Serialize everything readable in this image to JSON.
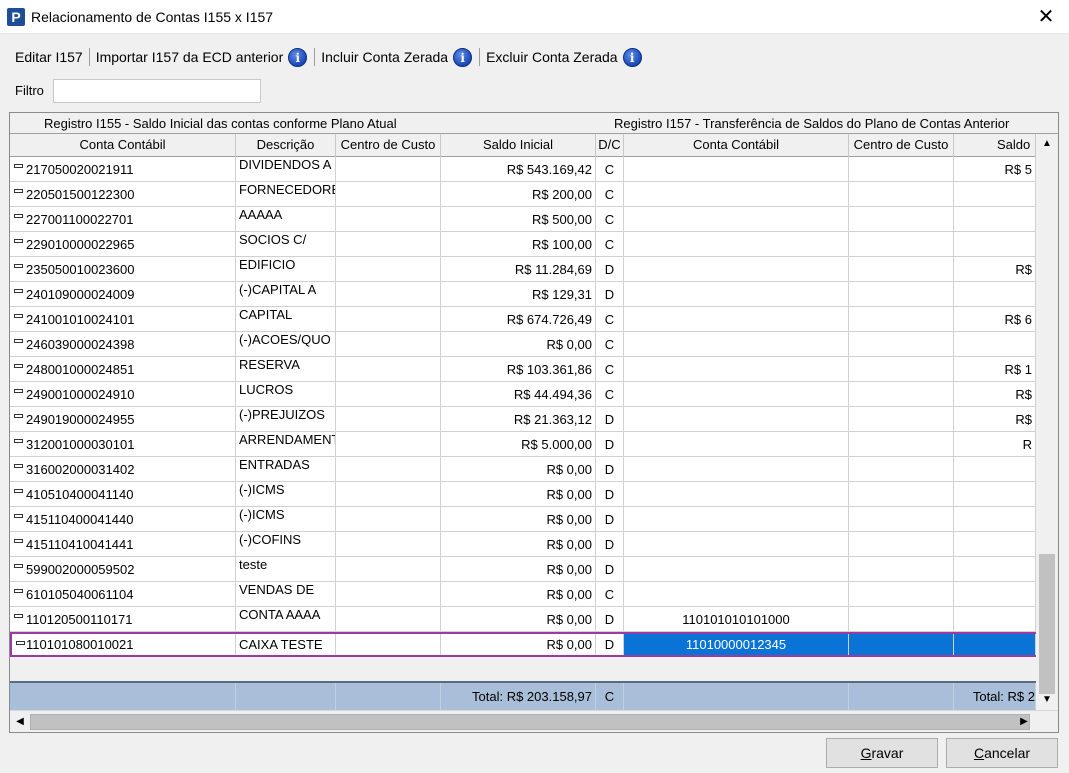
{
  "window": {
    "title": "Relacionamento de Contas I155 x I157",
    "close_glyph": "✕"
  },
  "toolbar": {
    "edit_label": "Editar I157",
    "import_label": "Importar I157 da ECD anterior",
    "include_label": "Incluir Conta Zerada",
    "exclude_label": "Excluir Conta Zerada",
    "info_glyph": "i"
  },
  "filter": {
    "label": "Filtro",
    "value": ""
  },
  "grid": {
    "group_left": "Registro I155 - Saldo Inicial das contas conforme Plano Atual",
    "group_right": "Registro I157 - Transferência de Saldos do Plano de Contas Anterior",
    "columns": [
      "Conta Contábil",
      "Descrição",
      "Centro de Custo",
      "Saldo Inicial",
      "D/C",
      "Conta Contábil",
      "Centro de Custo",
      "Saldo Ini"
    ],
    "rows": [
      {
        "conta": "217050020021911",
        "desc": "DIVIDENDOS A",
        "cc": "",
        "saldo": "R$ 543.169,42",
        "dc": "C",
        "conta2": "",
        "cc2": "",
        "saldo2": "R$ 5"
      },
      {
        "conta": "220501500122300",
        "desc": "FORNECEDORE",
        "cc": "",
        "saldo": "R$ 200,00",
        "dc": "C",
        "conta2": "",
        "cc2": "",
        "saldo2": ""
      },
      {
        "conta": "227001100022701",
        "desc": "AAAAA",
        "cc": "",
        "saldo": "R$ 500,00",
        "dc": "C",
        "conta2": "",
        "cc2": "",
        "saldo2": ""
      },
      {
        "conta": "229010000022965",
        "desc": "SOCIOS C/",
        "cc": "",
        "saldo": "R$ 100,00",
        "dc": "C",
        "conta2": "",
        "cc2": "",
        "saldo2": ""
      },
      {
        "conta": "235050010023600",
        "desc": "EDIFICIO",
        "cc": "",
        "saldo": "R$ 11.284,69",
        "dc": "D",
        "conta2": "",
        "cc2": "",
        "saldo2": "R$"
      },
      {
        "conta": "240109000024009",
        "desc": "(-)CAPITAL A",
        "cc": "",
        "saldo": "R$ 129,31",
        "dc": "D",
        "conta2": "",
        "cc2": "",
        "saldo2": ""
      },
      {
        "conta": "241001010024101",
        "desc": "CAPITAL",
        "cc": "",
        "saldo": "R$ 674.726,49",
        "dc": "C",
        "conta2": "",
        "cc2": "",
        "saldo2": "R$ 6"
      },
      {
        "conta": "246039000024398",
        "desc": "(-)ACOES/QUO",
        "cc": "",
        "saldo": "R$ 0,00",
        "dc": "C",
        "conta2": "",
        "cc2": "",
        "saldo2": ""
      },
      {
        "conta": "248001000024851",
        "desc": "RESERVA",
        "cc": "",
        "saldo": "R$ 103.361,86",
        "dc": "C",
        "conta2": "",
        "cc2": "",
        "saldo2": "R$ 1"
      },
      {
        "conta": "249001000024910",
        "desc": "LUCROS",
        "cc": "",
        "saldo": "R$ 44.494,36",
        "dc": "C",
        "conta2": "",
        "cc2": "",
        "saldo2": "R$"
      },
      {
        "conta": "249019000024955",
        "desc": "(-)PREJUIZOS",
        "cc": "",
        "saldo": "R$ 21.363,12",
        "dc": "D",
        "conta2": "",
        "cc2": "",
        "saldo2": "R$"
      },
      {
        "conta": "312001000030101",
        "desc": "ARRENDAMENT",
        "cc": "",
        "saldo": "R$ 5.000,00",
        "dc": "D",
        "conta2": "",
        "cc2": "",
        "saldo2": "R"
      },
      {
        "conta": "316002000031402",
        "desc": "ENTRADAS",
        "cc": "",
        "saldo": "R$ 0,00",
        "dc": "D",
        "conta2": "",
        "cc2": "",
        "saldo2": ""
      },
      {
        "conta": "410510400041140",
        "desc": "(-)ICMS",
        "cc": "",
        "saldo": "R$ 0,00",
        "dc": "D",
        "conta2": "",
        "cc2": "",
        "saldo2": ""
      },
      {
        "conta": "415110400041440",
        "desc": "(-)ICMS",
        "cc": "",
        "saldo": "R$ 0,00",
        "dc": "D",
        "conta2": "",
        "cc2": "",
        "saldo2": ""
      },
      {
        "conta": "415110410041441",
        "desc": "(-)COFINS",
        "cc": "",
        "saldo": "R$ 0,00",
        "dc": "D",
        "conta2": "",
        "cc2": "",
        "saldo2": ""
      },
      {
        "conta": "599002000059502",
        "desc": "teste",
        "cc": "",
        "saldo": "R$ 0,00",
        "dc": "D",
        "conta2": "",
        "cc2": "",
        "saldo2": ""
      },
      {
        "conta": "610105040061104",
        "desc": "VENDAS DE",
        "cc": "",
        "saldo": "R$ 0,00",
        "dc": "C",
        "conta2": "",
        "cc2": "",
        "saldo2": ""
      },
      {
        "conta": "110120500110171",
        "desc": "CONTA AAAA",
        "cc": "",
        "saldo": "R$ 0,00",
        "dc": "D",
        "conta2": "110101010101000",
        "cc2": "",
        "saldo2": ""
      },
      {
        "conta": "110101080010021",
        "desc": "CAIXA TESTE",
        "cc": "",
        "saldo": "R$ 0,00",
        "dc": "D",
        "conta2": "11010000012345",
        "cc2": "",
        "saldo2": ""
      }
    ],
    "selected_row": 19,
    "total_left": "Total: R$ 203.158,97",
    "total_dc": "C",
    "total_right": "Total: R$ 2"
  },
  "buttons": {
    "save_label": "Gravar",
    "save_accel": "G",
    "save_rest": "ravar",
    "cancel_label": "Cancelar",
    "cancel_accel": "C",
    "cancel_rest": "ancelar"
  },
  "colors": {
    "selection": "#0a74d6",
    "selected_row_border": "#9b3aa4",
    "total_row": "#a9bfd9"
  }
}
